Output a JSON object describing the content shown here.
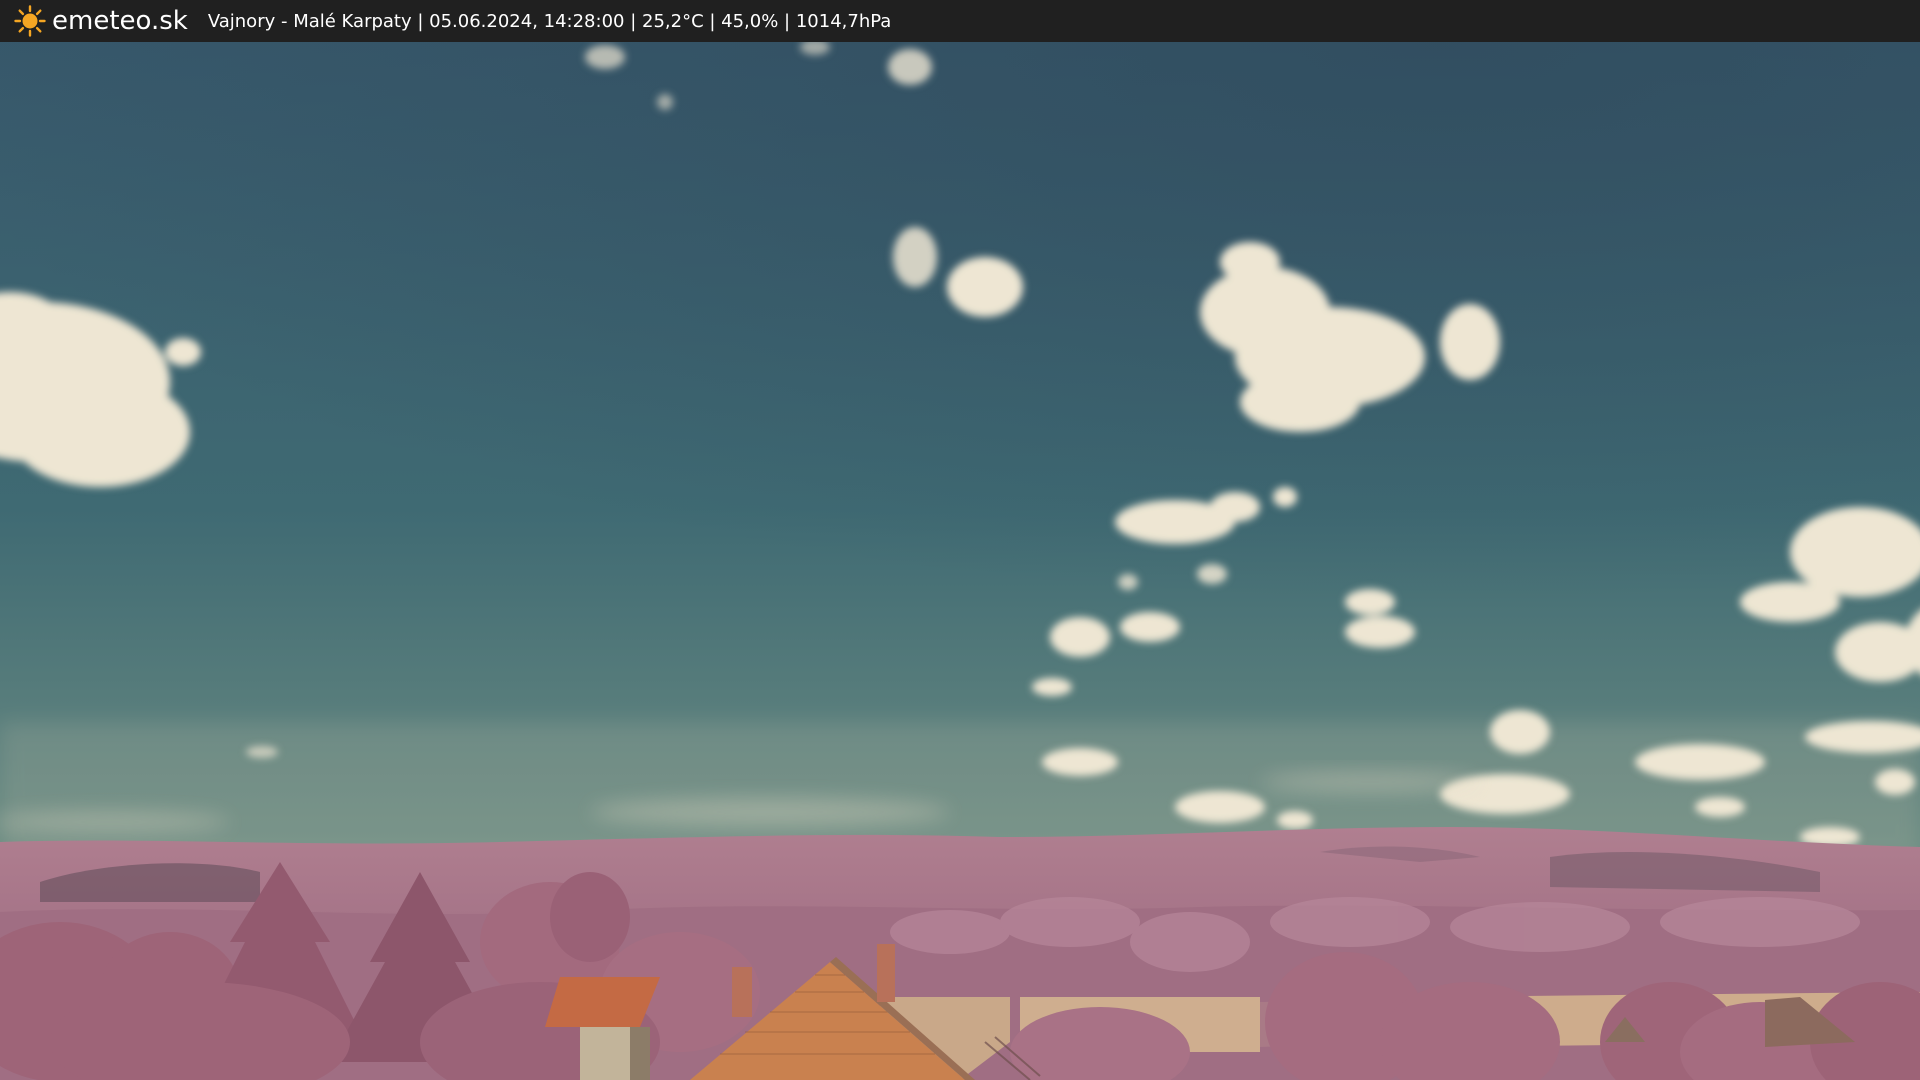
{
  "header": {
    "logo_text": "emeteo.sk",
    "logo_icon": "sun-icon",
    "caption": "Vajnory - Malé Karpaty | 05.06.2024, 14:28:00 | 25,2°C | 45,0% | 1014,7hPa"
  },
  "colors": {
    "bar_background": "#202020",
    "sun": "#f5a623",
    "sky_top": "#36576a",
    "sky_bottom": "#7e9a8c",
    "foliage": "#a86f84",
    "field": "#c9a888",
    "roof": "#c0603a"
  }
}
